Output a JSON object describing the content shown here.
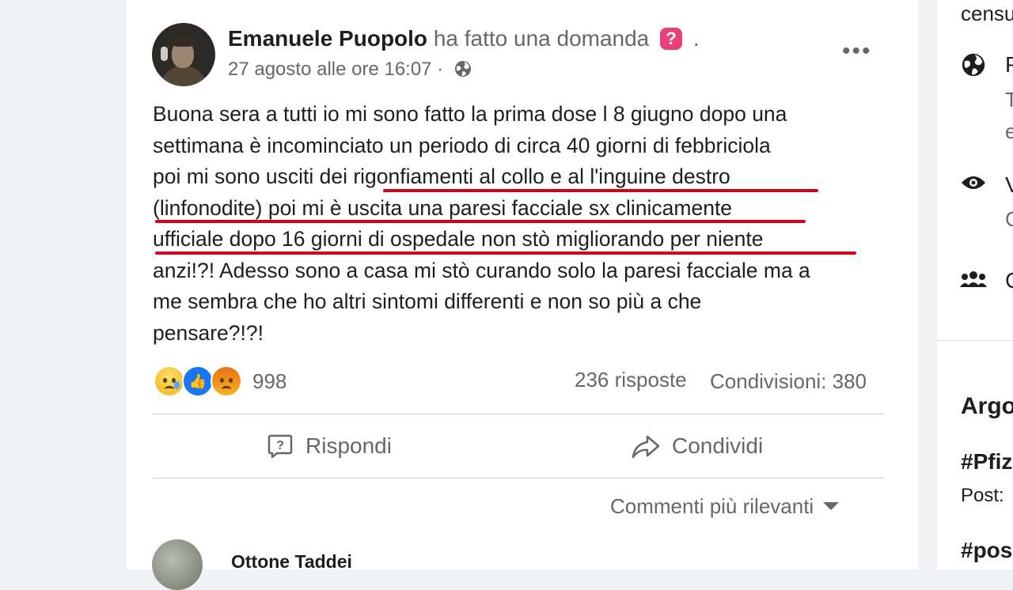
{
  "post": {
    "author": "Emanuele Puopolo",
    "action": "ha fatto una domanda",
    "question_icon": "?",
    "dot": ".",
    "timestamp": "27 agosto alle ore 16:07",
    "separator": "·",
    "privacy_icon": "globe-icon",
    "more_label": "•••",
    "body_lines": [
      "Buona sera a tutti io mi sono fatto la prima dose l 8 giugno dopo una",
      "settimana è incominciato un periodo di circa 40 giorni di febbriciola",
      "poi mi sono usciti dei rigonfiamenti al collo e al l'inguine destro",
      "(linfonodite) poi mi è uscita una paresi facciale sx clinicamente",
      "ufficiale dopo 16 giorni di ospedale non stò migliorando per niente",
      "anzi!?! Adesso sono a casa mi stò curando solo la paresi facciale ma a",
      "me sembra che ho altri sintomi differenti e non so più a che",
      "pensare?!?!"
    ],
    "highlight_color": "#d0021b"
  },
  "reactions": {
    "types": [
      "sad",
      "like",
      "angry"
    ],
    "count": "998"
  },
  "stats": {
    "replies": "236 risposte",
    "shares": "Condivisioni: 380"
  },
  "actions": {
    "reply": "Rispondi",
    "share": "Condividi"
  },
  "comments": {
    "sort_label": "Commenti più rilevanti",
    "first_author": "Ottone Taddei"
  },
  "sidebar": {
    "top_text": "censu",
    "row1_line1": "P",
    "row1_line2": "T",
    "row1_line3": "e",
    "row2_line1": "V",
    "row2_line2": "C",
    "row3_line1": "C",
    "section_title": "Argo",
    "tag1": "#Pfiz",
    "tag1_sub": "Post:",
    "tag2": "#pos"
  },
  "colors": {
    "accent": "#1877f2",
    "text_secondary": "#65676b",
    "question_badge": "#e8407a"
  }
}
